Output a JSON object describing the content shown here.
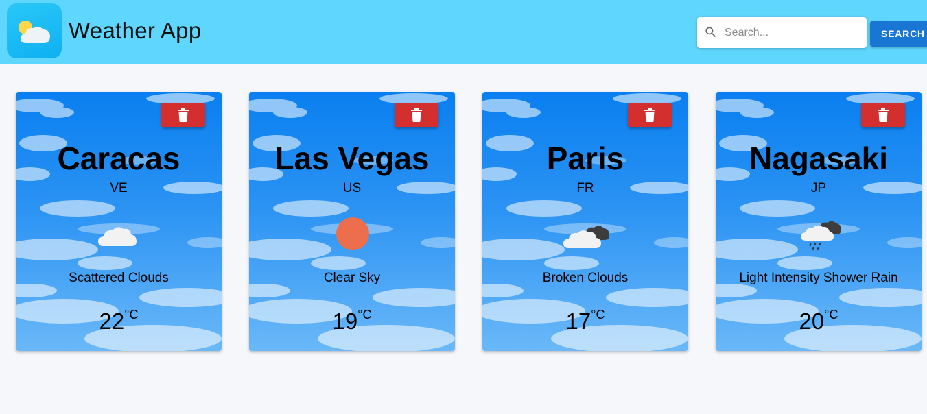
{
  "header": {
    "title": "Weather App",
    "logo_icon": "sun-cloud-logo-icon",
    "background": "#5fd6fd"
  },
  "search": {
    "placeholder": "Search...",
    "value": "",
    "button_label": "SEARCH"
  },
  "cards": [
    {
      "city": "Caracas",
      "country": "VE",
      "description": "Scattered Clouds",
      "temp": "22",
      "unit": "°C",
      "icon": "scattered-clouds-icon"
    },
    {
      "city": "Las Vegas",
      "country": "US",
      "description": "Clear Sky",
      "temp": "19",
      "unit": "°C",
      "icon": "clear-sky-sun-icon"
    },
    {
      "city": "Paris",
      "country": "FR",
      "description": "Broken Clouds",
      "temp": "17",
      "unit": "°C",
      "icon": "broken-clouds-icon"
    },
    {
      "city": "Nagasaki",
      "country": "JP",
      "description": "Light Intensity Shower Rain",
      "temp": "20",
      "unit": "°C",
      "icon": "shower-rain-icon"
    }
  ],
  "colors": {
    "accent": "#1976d2",
    "delete": "#d32f2f",
    "sun": "#ec6e4c"
  }
}
